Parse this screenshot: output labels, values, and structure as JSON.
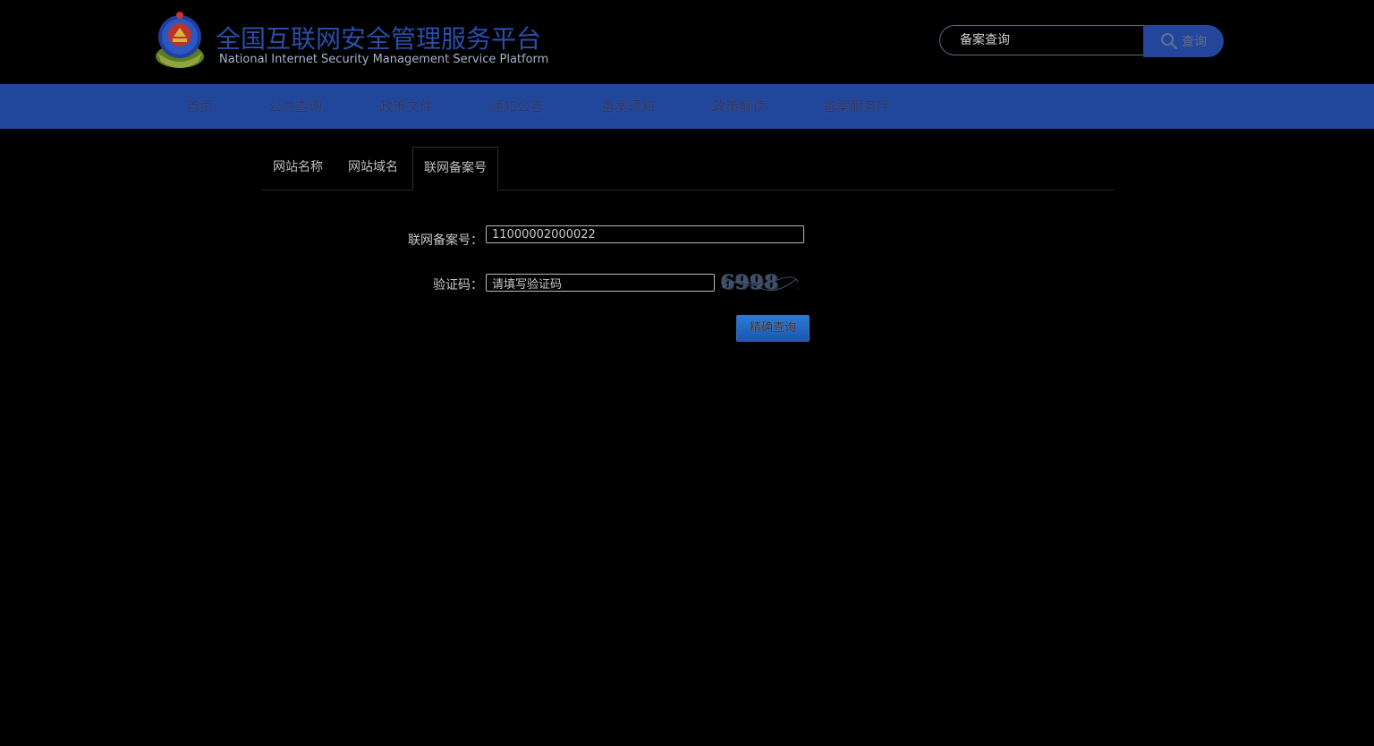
{
  "header": {
    "title_cn": "全国互联网安全管理服务平台",
    "title_en": "National Internet Security Management Service Platform",
    "search": {
      "value": "备案查询",
      "button_label": "查询"
    }
  },
  "nav": {
    "items": [
      {
        "label": "首页"
      },
      {
        "label": "公共查询"
      },
      {
        "label": "政策文件"
      },
      {
        "label": "通知公告"
      },
      {
        "label": "备案须知"
      },
      {
        "label": "政策解读"
      },
      {
        "label": "备案服务厅"
      }
    ]
  },
  "tabs": [
    {
      "label": "网站名称"
    },
    {
      "label": "网站域名"
    },
    {
      "label": "联网备案号"
    }
  ],
  "form": {
    "record_label": "联网备案号：",
    "record_value": "11000002000022",
    "captcha_label": "验证码：",
    "captcha_value": "请填写验证码",
    "captcha_text": "6998",
    "submit_label": "精确查询"
  },
  "colors": {
    "nav_bg": "#21479c",
    "brand_blue": "#2a4ea8",
    "search_button_bg": "#23469b"
  }
}
